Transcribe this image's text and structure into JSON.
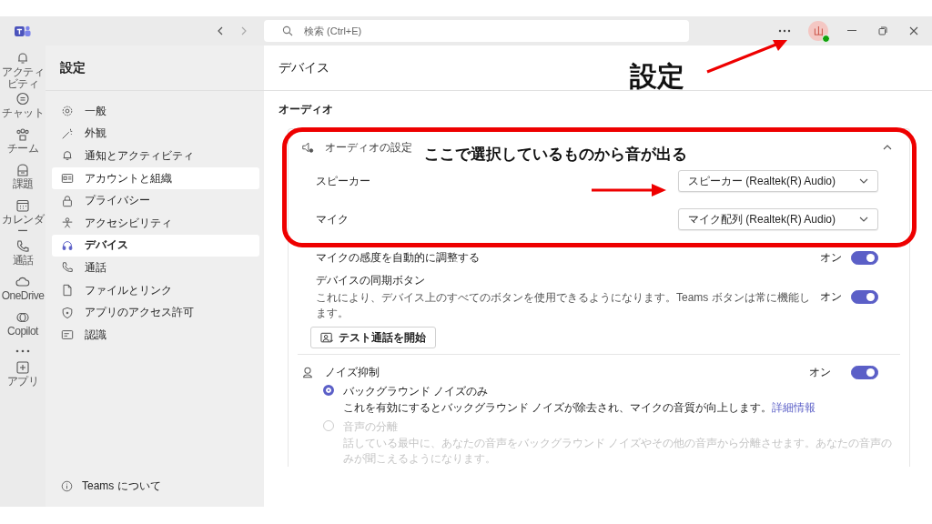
{
  "title_bar": {
    "search_placeholder": "検索 (Ctrl+E)",
    "avatar": "山"
  },
  "app_bar": [
    {
      "label": "アクティビティ"
    },
    {
      "label": "チャット"
    },
    {
      "label": "チーム"
    },
    {
      "label": "課題"
    },
    {
      "label": "カレンダー"
    },
    {
      "label": "通話"
    },
    {
      "label": "OneDrive"
    },
    {
      "label": "Copilot"
    },
    {
      "label": "アプリ"
    }
  ],
  "settings_nav": {
    "title": "設定",
    "items": [
      {
        "label": "一般",
        "selected": false,
        "hovered": false
      },
      {
        "label": "外観",
        "selected": false,
        "hovered": false
      },
      {
        "label": "通知とアクティビティ",
        "selected": false,
        "hovered": false
      },
      {
        "label": "アカウントと組織",
        "selected": false,
        "hovered": true
      },
      {
        "label": "プライバシー",
        "selected": false,
        "hovered": false
      },
      {
        "label": "アクセシビリティ",
        "selected": false,
        "hovered": false
      },
      {
        "label": "デバイス",
        "selected": true,
        "hovered": false
      },
      {
        "label": "通話",
        "selected": false,
        "hovered": false
      },
      {
        "label": "ファイルとリンク",
        "selected": false,
        "hovered": false
      },
      {
        "label": "アプリのアクセス許可",
        "selected": false,
        "hovered": false
      },
      {
        "label": "認識",
        "selected": false,
        "hovered": false
      }
    ],
    "about": "Teams について"
  },
  "page": {
    "title": "デバイス",
    "section": "オーディオ",
    "audio_card": {
      "title": "オーディオの設定",
      "expanded": true,
      "dropdowns": [
        {
          "label": "スピーカー",
          "value": "スピーカー (Realtek(R) Audio)"
        },
        {
          "label": "マイク",
          "value": "マイク配列 (Realtek(R) Audio)"
        }
      ],
      "toggles": [
        {
          "label": "マイクの感度を自動的に調整する",
          "state": "オン",
          "on": true
        },
        {
          "label": "デバイスの同期ボタン",
          "description": "これにより、デバイス上のすべてのボタンを使用できるようになります。Teams ボタンは常に機能します。",
          "state": "オン",
          "on": true
        }
      ],
      "test_button": "テスト通話を開始"
    },
    "noise": {
      "title": "ノイズ抑制",
      "state": "オン",
      "on": true,
      "options": [
        {
          "label": "バックグラウンド ノイズのみ",
          "description": "これを有効にするとバックグラウンド ノイズが除去され、マイクの音質が向上します。",
          "link": "詳細情報",
          "selected": true,
          "disabled": false
        },
        {
          "label": "音声の分離",
          "description": "話している最中に、あなたの音声をバックグラウンド ノイズやその他の音声から分離させます。あなたの音声のみが聞こえるようになります。",
          "selected": false,
          "disabled": true
        }
      ]
    }
  },
  "annotations": {
    "settings_label": "設定",
    "audio_note": "ここで選択しているものから音が出る"
  }
}
